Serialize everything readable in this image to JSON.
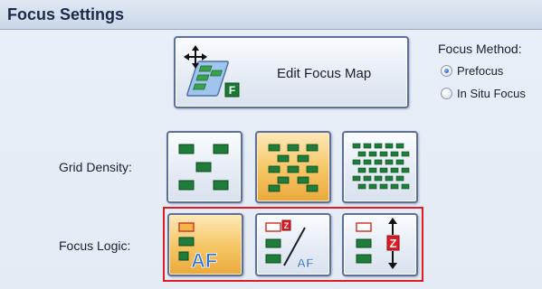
{
  "panel": {
    "title": "Focus Settings"
  },
  "edit_focus_map": {
    "label": "Edit Focus Map",
    "icon": "focus-map-icon"
  },
  "focus_method": {
    "label": "Focus Method:",
    "options": [
      {
        "label": "Prefocus",
        "selected": true
      },
      {
        "label": "In Situ Focus",
        "selected": false
      }
    ]
  },
  "grid_density": {
    "label": "Grid Density:",
    "options": [
      {
        "name": "low",
        "selected": false
      },
      {
        "name": "medium",
        "selected": true
      },
      {
        "name": "high",
        "selected": false
      }
    ]
  },
  "focus_logic": {
    "label": "Focus Logic:",
    "options": [
      {
        "name": "autofocus",
        "icon_text": "AF",
        "selected": true
      },
      {
        "name": "mixed",
        "icon_text": "AF",
        "selected": false
      },
      {
        "name": "z-stack",
        "icon_text": "Z",
        "selected": false
      }
    ]
  },
  "colors": {
    "selected_fill": "#f4c15e",
    "tile_border": "#5e6f98",
    "marker_green": "#1e7d3a",
    "highlight_red": "#e11b22",
    "af_blue": "#2f72d0"
  }
}
